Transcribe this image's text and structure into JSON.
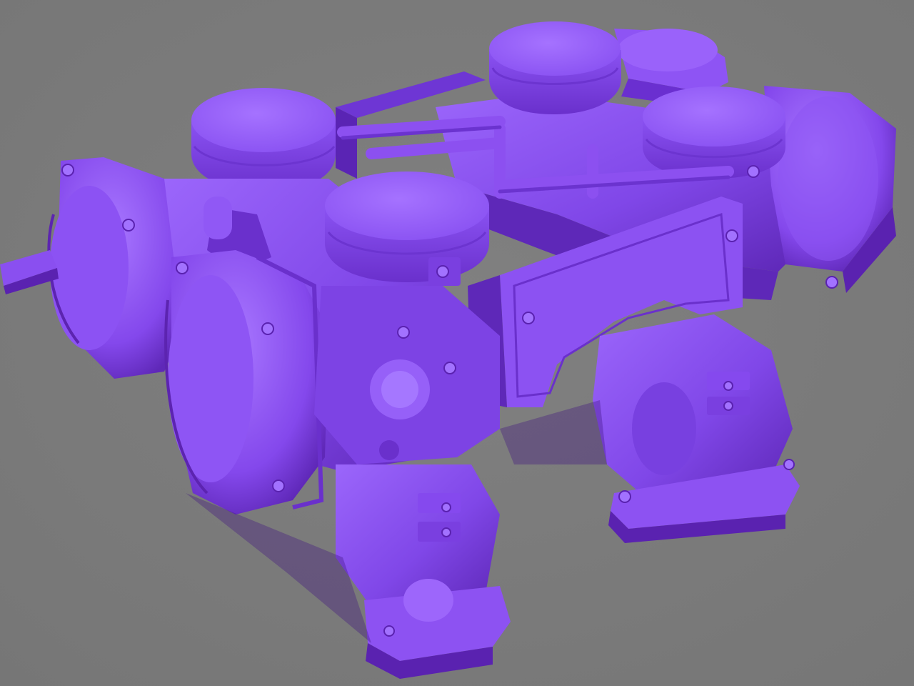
{
  "scene": {
    "subject": "",
    "colors": {
      "background": "#7d7d7d",
      "body_base": "#8a4ff0",
      "body_light": "#a070ff",
      "body_mid": "#7a3fe0",
      "body_dark": "#5a22b0",
      "body_deep": "#3e1280",
      "cap_top": "#9a62fa"
    }
  }
}
